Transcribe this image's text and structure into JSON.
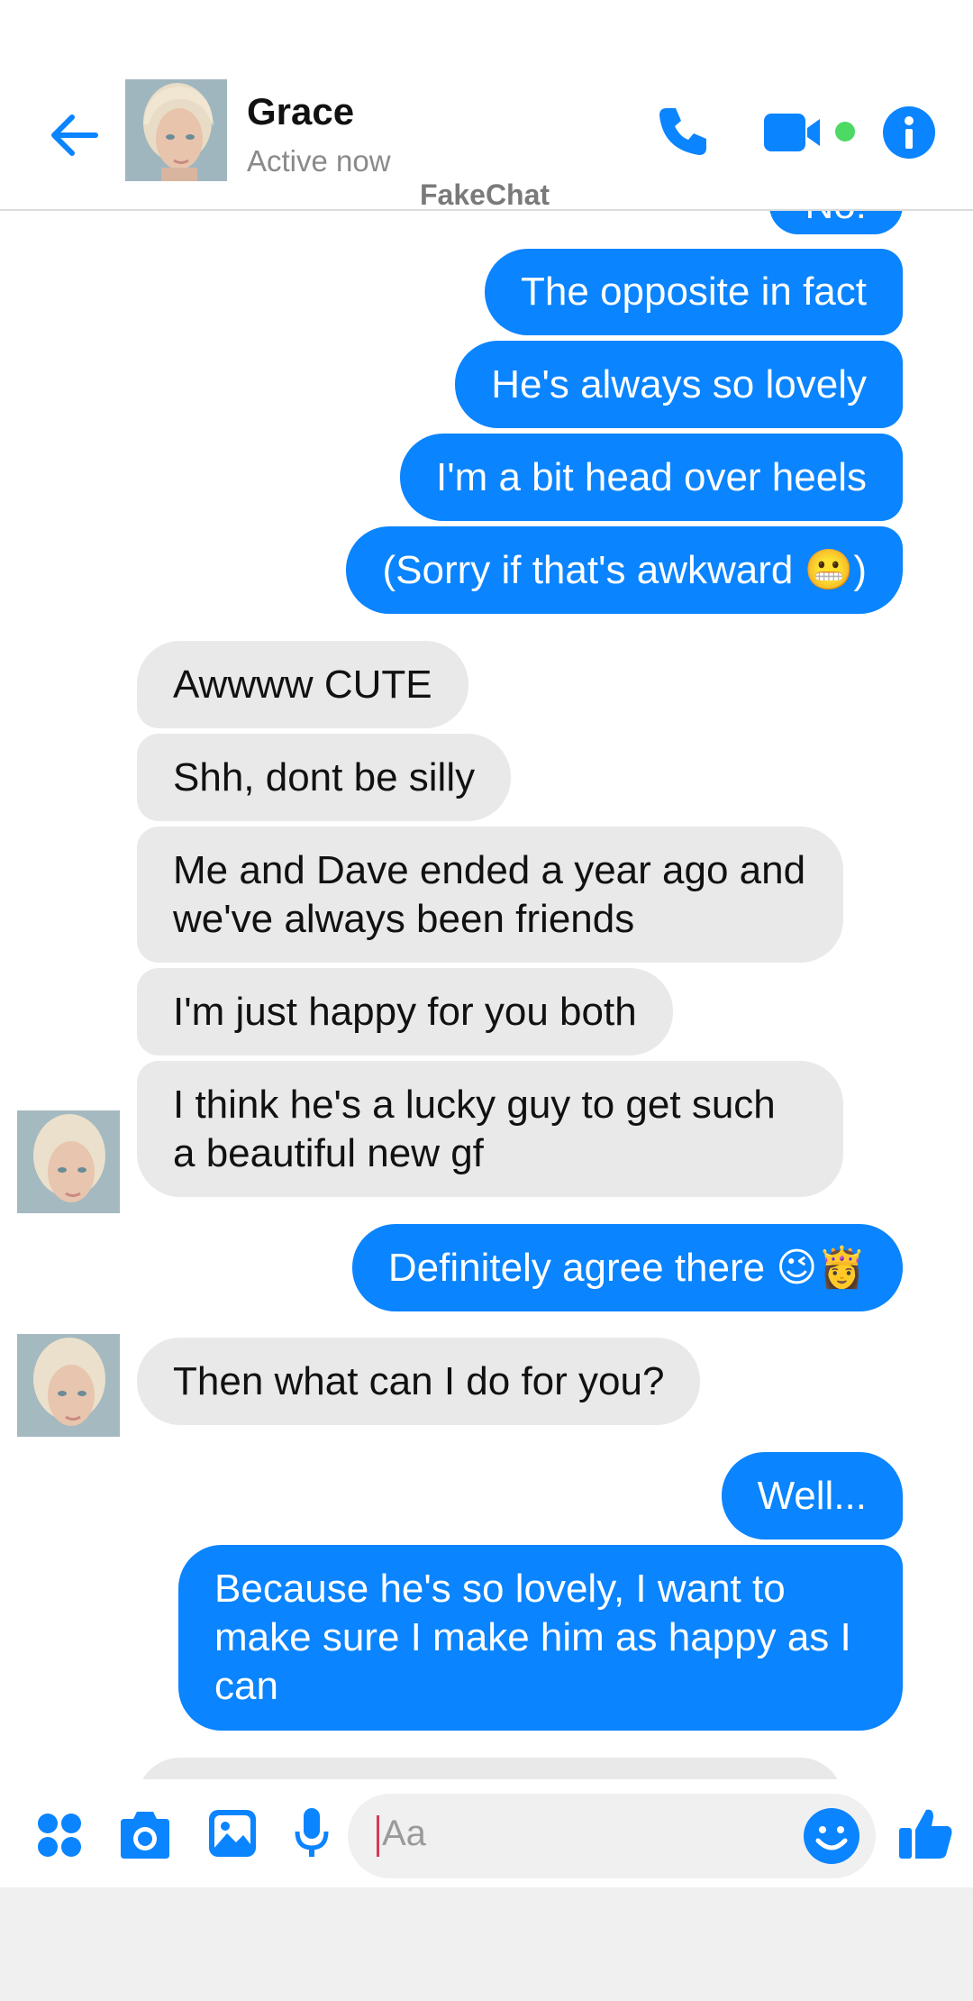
{
  "header": {
    "contact_name": "Grace",
    "status": "Active now",
    "watermark": "FakeChat",
    "icons": [
      "back-arrow-icon",
      "phone-icon",
      "video-camera-icon",
      "active-dot-icon",
      "info-icon"
    ],
    "accent_color": "#0a84ff",
    "online_color": "#4cd964"
  },
  "messages": [
    {
      "from": "me",
      "text": "No!"
    },
    {
      "from": "me",
      "text": "The opposite in fact"
    },
    {
      "from": "me",
      "text": "He's always so lovely"
    },
    {
      "from": "me",
      "text": "I'm a bit head over heels"
    },
    {
      "from": "me",
      "text": "(Sorry if that's awkward 😬)"
    },
    {
      "from": "them",
      "text": "Awwww CUTE"
    },
    {
      "from": "them",
      "text": "Shh, dont be silly"
    },
    {
      "from": "them",
      "text": "Me and Dave ended a year ago and we've always been friends"
    },
    {
      "from": "them",
      "text": "I'm just happy for you both"
    },
    {
      "from": "them",
      "text": "I think he's a lucky guy to get such a beautiful new gf"
    },
    {
      "from": "me",
      "text": "Definitely agree there 😉👸"
    },
    {
      "from": "them",
      "text": "Then what can I do for you?"
    },
    {
      "from": "me",
      "text": "Well..."
    },
    {
      "from": "me",
      "text": "Because he's so lovely, I want to make sure I make him as happy as I can"
    }
  ],
  "composer": {
    "placeholder": "Aa",
    "icons": [
      "apps-icon",
      "camera-icon",
      "gallery-icon",
      "microphone-icon",
      "emoji-icon",
      "thumbs-up-icon"
    ]
  },
  "colors": {
    "outgoing": "#0a84ff",
    "incoming": "#e9e9e9",
    "header_border": "#dcdcdc"
  }
}
